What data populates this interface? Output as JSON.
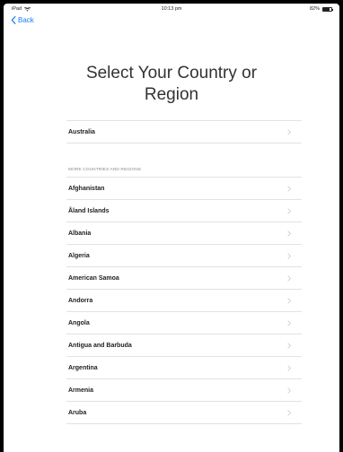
{
  "status_bar": {
    "device": "iPad",
    "time": "10:13 pm",
    "battery": "82%",
    "battery_level": 0.82
  },
  "nav": {
    "back_label": "Back"
  },
  "title_line1": "Select Your Country or",
  "title_line2": "Region",
  "suggested": [
    {
      "label": "Australia"
    }
  ],
  "section_header": "MORE COUNTRIES AND REGIONS",
  "countries": [
    {
      "label": "Afghanistan"
    },
    {
      "label": "Åland Islands"
    },
    {
      "label": "Albania"
    },
    {
      "label": "Algeria"
    },
    {
      "label": "American Samoa"
    },
    {
      "label": "Andorra"
    },
    {
      "label": "Angola"
    },
    {
      "label": "Antigua and Barbuda"
    },
    {
      "label": "Argentina"
    },
    {
      "label": "Armenia"
    },
    {
      "label": "Aruba"
    }
  ],
  "colors": {
    "accent": "#1a7cf7",
    "separator": "#e2e2e2",
    "chevron": "#c7c7cc"
  },
  "icons": {
    "back": "chevron-left-icon",
    "row": "chevron-right-icon",
    "wifi": "wifi-icon",
    "battery": "battery-icon"
  }
}
